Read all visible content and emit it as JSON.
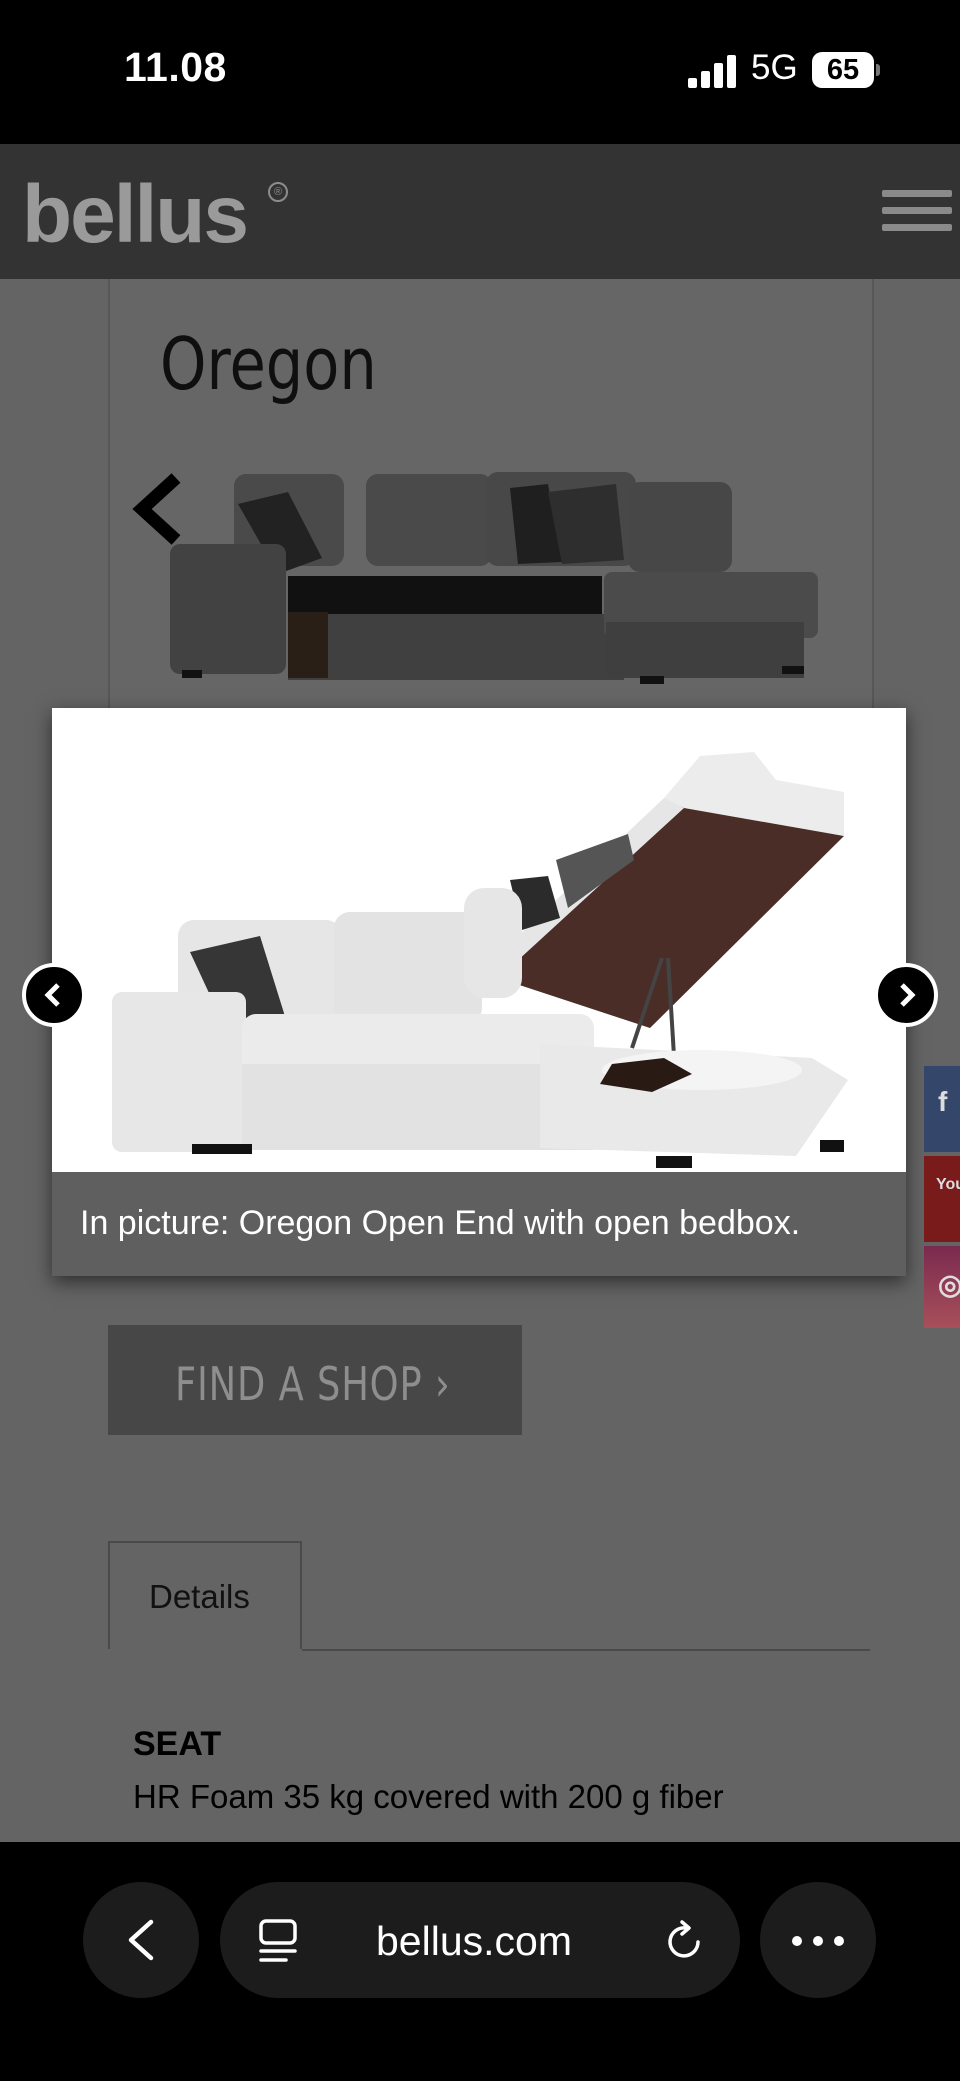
{
  "status_bar": {
    "time": "11.08",
    "network": "5G",
    "battery": "65"
  },
  "header": {
    "logo": "bellus",
    "logo_mark": "®",
    "menu_icon": "hamburger-menu-icon"
  },
  "product": {
    "title": "Oregon"
  },
  "lightbox": {
    "caption": "In picture: Oregon Open End with open bedbox.",
    "prev_icon": "chevron-left-icon",
    "next_icon": "chevron-right-icon"
  },
  "social": {
    "facebook": "f",
    "youtube": "You",
    "instagram": "◎"
  },
  "find_shop": {
    "label": "FIND A SHOP  ›"
  },
  "details": {
    "tab_label": "Details",
    "seat_heading": "SEAT",
    "seat_text": "HR Foam 35 kg covered with 200 g fiber"
  },
  "browser": {
    "url": "bellus.com",
    "back_icon": "back-chevron-icon",
    "tabs_icon": "tabs-icon",
    "reload_icon": "reload-icon",
    "more_icon": "more-dots-icon"
  }
}
